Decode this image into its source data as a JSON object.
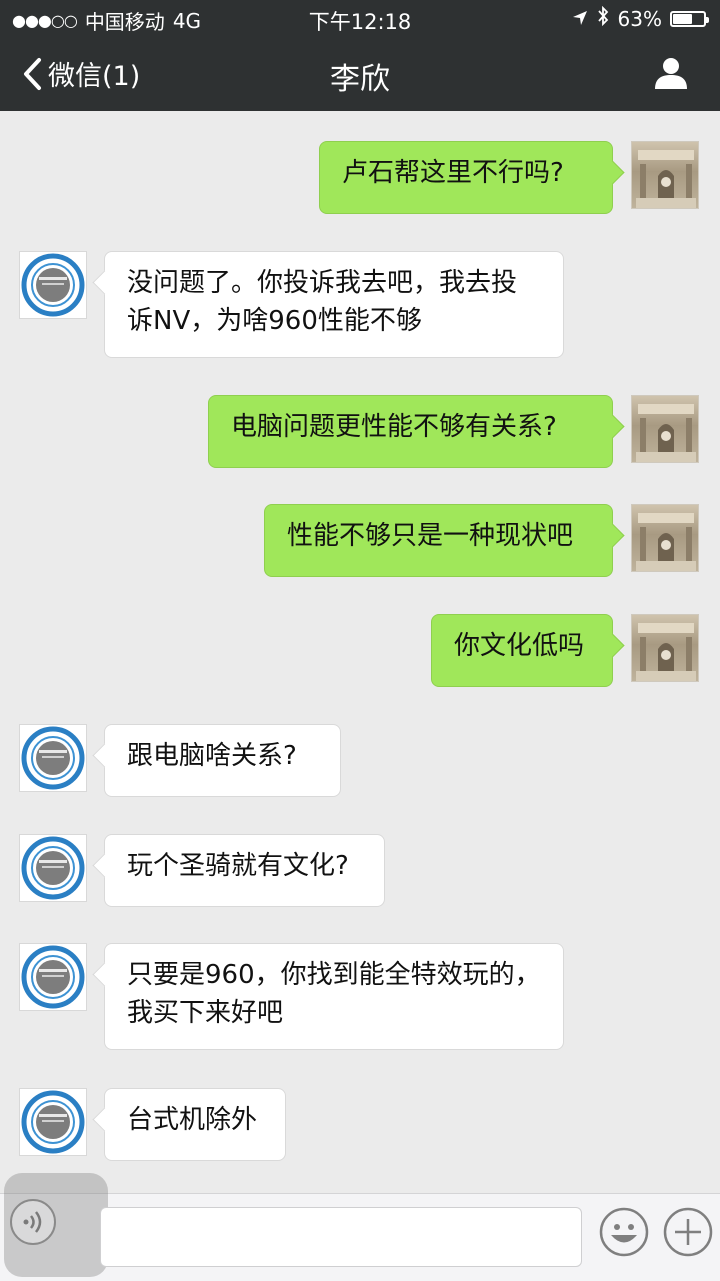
{
  "status_bar": {
    "carrier": "中国移动",
    "network": "4G",
    "time": "下午12:18",
    "battery": "63%",
    "battery_level": 0.63
  },
  "nav": {
    "back_label": "微信(1)",
    "title": "李欣",
    "contact_icon": "person-icon"
  },
  "messages": [
    {
      "from": "me",
      "text": "卢石帮这里不行吗?"
    },
    {
      "from": "friend",
      "text": "没问题了。你投诉我去吧，我去投诉NV，为啥960性能不够"
    },
    {
      "from": "me",
      "text": "电脑问题更性能不够有关系?"
    },
    {
      "from": "me",
      "text": "性能不够只是一种现状吧"
    },
    {
      "from": "me",
      "text": "你文化低吗"
    },
    {
      "from": "friend",
      "text": "跟电脑啥关系?"
    },
    {
      "from": "friend",
      "text": "玩个圣骑就有文化?"
    },
    {
      "from": "friend",
      "text": "只要是960，你找到能全特效玩的，我买下来好吧"
    },
    {
      "from": "friend",
      "text": "台式机除外"
    }
  ],
  "input_bar": {
    "voice_icon": "voice-icon",
    "emoji_icon": "emoji-icon",
    "plus_icon": "plus-icon"
  },
  "colors": {
    "nav_bg": "#2e3132",
    "chat_bg": "#ebebeb",
    "my_bubble": "#a0e75a",
    "friend_bubble": "#ffffff"
  }
}
